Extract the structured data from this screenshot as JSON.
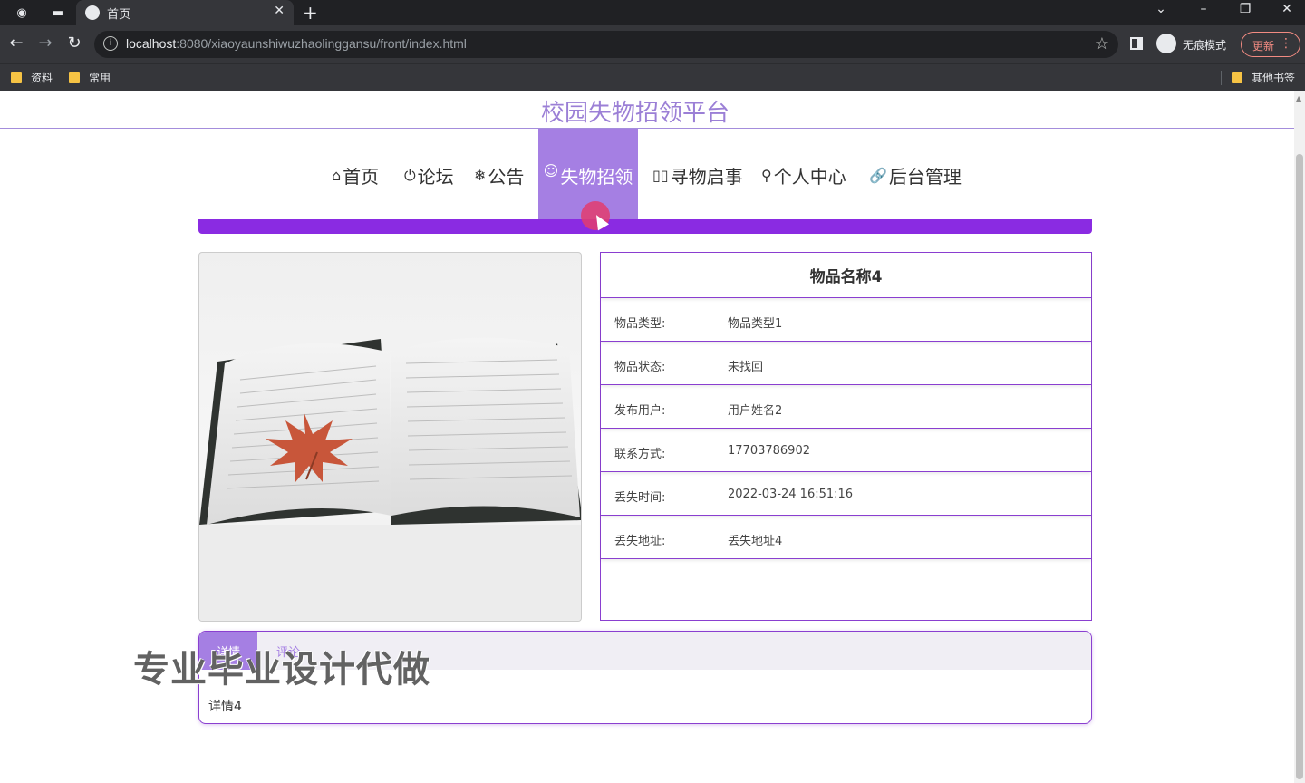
{
  "browser": {
    "tab_title": "首页",
    "url_host": "localhost",
    "url_rest": ":8080/xiaoyaunshiwuzhaolinggansu/front/index.html",
    "incognito_label": "无痕模式",
    "update_label": "更新",
    "bookmarks": [
      {
        "label": "资料"
      },
      {
        "label": "常用"
      },
      {
        "label": "其他书签"
      }
    ]
  },
  "site": {
    "title": "校园失物招领平台"
  },
  "nav": [
    {
      "icon": "⌂",
      "label": "首页",
      "active": false
    },
    {
      "icon": "⏻",
      "label": "论坛",
      "active": false
    },
    {
      "icon": "❄",
      "label": "公告",
      "active": false
    },
    {
      "icon": "☺",
      "label": "失物招领",
      "active": true
    },
    {
      "icon": "▯▯",
      "label": "寻物启事",
      "active": false
    },
    {
      "icon": "⚲",
      "label": "个人中心",
      "active": false
    },
    {
      "icon": "🔗",
      "label": "后台管理",
      "active": false
    }
  ],
  "item": {
    "name": "物品名称4",
    "fields": [
      {
        "key": "物品类型:",
        "value": "物品类型1"
      },
      {
        "key": "物品状态:",
        "value": "未找回"
      },
      {
        "key": "发布用户:",
        "value": "用户姓名2"
      },
      {
        "key": "联系方式:",
        "value": "17703786902"
      },
      {
        "key": "丢失时间:",
        "value": "2022-03-24 16:51:16"
      },
      {
        "key": "丢失地址:",
        "value": "丢失地址4"
      }
    ]
  },
  "detail": {
    "tab_active": "详情",
    "tab_other": "评论",
    "body": "详情4"
  },
  "watermark": "专业毕业设计代做",
  "colors": {
    "accent": "#a57fe3",
    "accent_dark": "#8a2be2",
    "title": "#9b7fd6"
  }
}
